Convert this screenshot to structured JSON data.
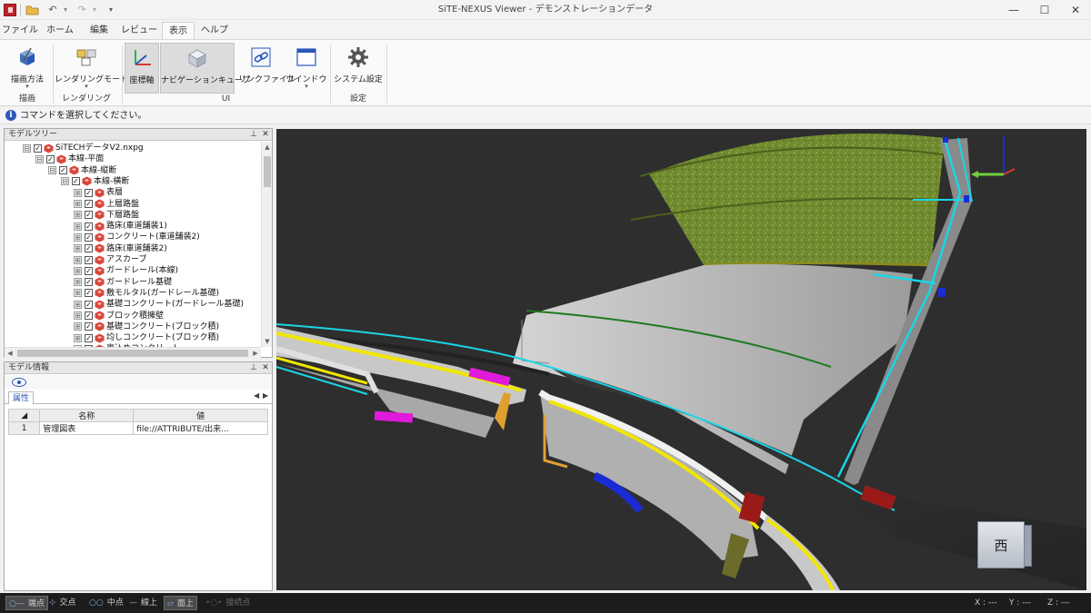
{
  "window": {
    "title": "SiTE-NEXUS Viewer - デモンストレーションデータ",
    "minimize": "—",
    "maximize": "☐",
    "close": "✕"
  },
  "quick_access": {
    "open_icon": "folder-open-icon",
    "undo_icon": "undo-icon",
    "redo_icon": "redo-icon",
    "customize_icon": "dropdown-icon"
  },
  "menu": {
    "tabs": [
      "ファイル",
      "ホーム",
      "編集",
      "レビュー",
      "表示",
      "ヘルプ"
    ],
    "active": "表示"
  },
  "ribbon": {
    "buttons": {
      "draw_method": "描画方法",
      "render_mode": "レンダリングモード",
      "axis": "座標軸",
      "navcube": "ナビゲーションキューブ",
      "link_file": "リンクファイル",
      "window": "ウインドウ",
      "settings": "システム設定"
    },
    "groups": {
      "draw": "描画",
      "render": "レンダリング",
      "ui": "UI",
      "settings": "設定"
    },
    "drop_glyph": "▾"
  },
  "hint": {
    "text": "コマンドを選択してください。"
  },
  "model_tree": {
    "title": "モデルツリー",
    "pin": "⊥",
    "close": "✕",
    "items": [
      {
        "label": "SiTECHデータV2.nxpg",
        "level": 0,
        "expander": "⊟"
      },
      {
        "label": "本線-平面",
        "level": 1,
        "expander": "⊟"
      },
      {
        "label": "本線-縦断",
        "level": 2,
        "expander": "⊟"
      },
      {
        "label": "本線-横断",
        "level": 3,
        "expander": "⊟"
      },
      {
        "label": "表層",
        "level": 4,
        "expander": "⊞"
      },
      {
        "label": "上層路盤",
        "level": 4,
        "expander": "⊞"
      },
      {
        "label": "下層路盤",
        "level": 4,
        "expander": "⊞"
      },
      {
        "label": "路床(車道舗装1)",
        "level": 4,
        "expander": "⊞"
      },
      {
        "label": "コンクリート(車道舗装2)",
        "level": 4,
        "expander": "⊞"
      },
      {
        "label": "路床(車道舗装2)",
        "level": 4,
        "expander": "⊞"
      },
      {
        "label": "アスカーブ",
        "level": 4,
        "expander": "⊞"
      },
      {
        "label": "ガードレール(本線)",
        "level": 4,
        "expander": "⊞"
      },
      {
        "label": "ガードレール基礎",
        "level": 4,
        "expander": "⊞"
      },
      {
        "label": "敷モルタル(ガードレール基礎)",
        "level": 4,
        "expander": "⊞"
      },
      {
        "label": "基礎コンクリート(ガードレール基礎)",
        "level": 4,
        "expander": "⊞"
      },
      {
        "label": "ブロック積擁壁",
        "level": 4,
        "expander": "⊞"
      },
      {
        "label": "基礎コンクリート(ブロック積)",
        "level": 4,
        "expander": "⊞"
      },
      {
        "label": "均しコンクリート(ブロック積)",
        "level": 4,
        "expander": "⊞"
      },
      {
        "label": "裏込めコンクリート",
        "level": 4,
        "expander": "⊞"
      }
    ],
    "check": "✓",
    "node_color": "#d9473c"
  },
  "model_info": {
    "title": "モデル情報",
    "pin": "⊥",
    "close": "✕",
    "tab": "属性",
    "nav_prev": "◀",
    "nav_next": "▶",
    "columns": [
      "名称",
      "値"
    ],
    "rows": [
      {
        "index": "1",
        "name": "管理図表",
        "value": "file://ATTRIBUTE/出来..."
      }
    ]
  },
  "viewport": {
    "navcube_face": "西",
    "colors": {
      "background": "#2e2e2e",
      "grass": "#6f8a2f",
      "slope": "#b9b9b9",
      "cyan_line": "#19d6e6",
      "magenta": "#e01adb",
      "yellow": "#f2e600",
      "blue": "#1a2bd6",
      "red": "#9a1a1a"
    }
  },
  "status": {
    "snaps": [
      {
        "label": "端点",
        "icon": "○—",
        "state": "on"
      },
      {
        "label": "交点",
        "icon": "⊹",
        "state": "off"
      },
      {
        "label": "中点",
        "icon": "○○",
        "state": "off"
      },
      {
        "label": "線上",
        "icon": "—",
        "state": "off"
      },
      {
        "label": "面上",
        "icon": "▱",
        "state": "on"
      },
      {
        "label": "接続点",
        "icon": "•○•",
        "state": "dim"
      }
    ],
    "x": "X : ---",
    "y": "Y : ---",
    "z": "Z : ---"
  }
}
